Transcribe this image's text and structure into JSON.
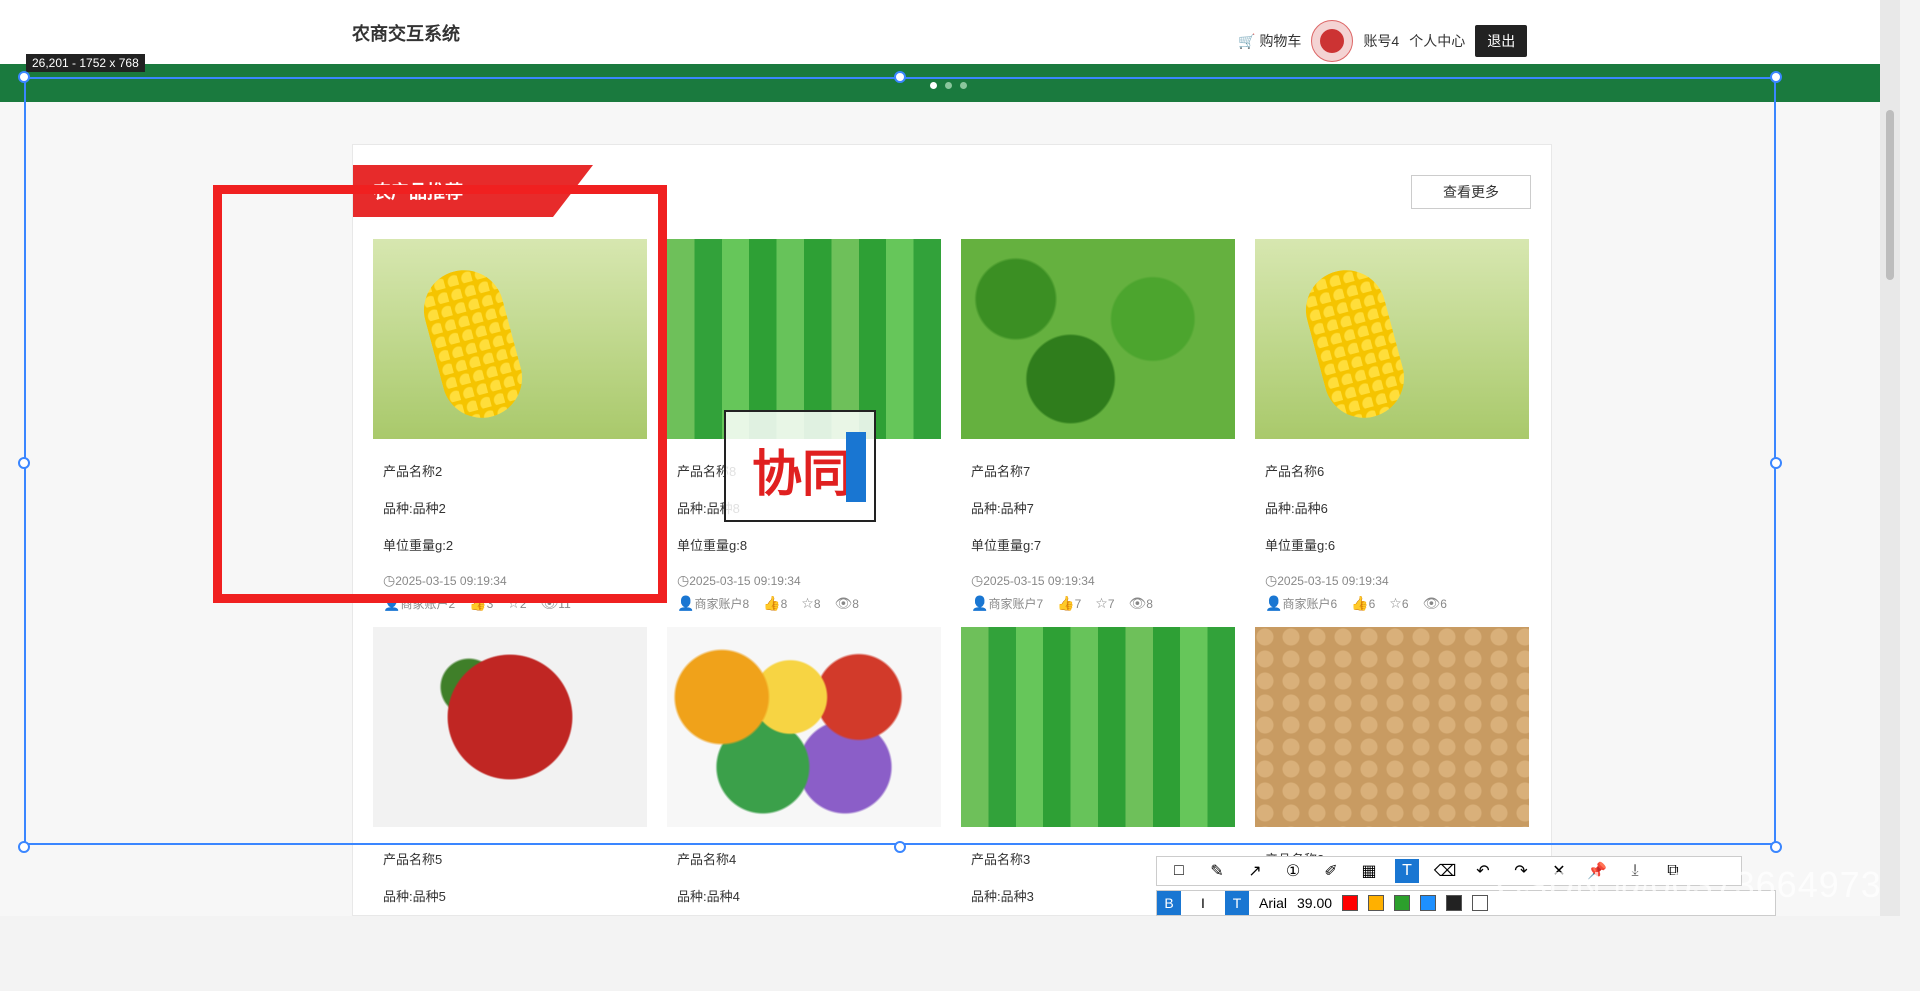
{
  "header": {
    "brand": "农商交互系统",
    "cart_label": "购物车",
    "account_label": "账号4",
    "personal_center": "个人中心",
    "logout": "退出"
  },
  "overlay": {
    "selection_size": "26,201 - 1752 x 768",
    "textbox_text": "协同"
  },
  "section": {
    "title": "农产品推荐",
    "more": "查看更多"
  },
  "products": [
    {
      "name": "产品名称2",
      "variety": "品种:品种2",
      "weight": "单位重量g:2",
      "time": "2025-03-15 09:19:34",
      "merchant": "商家账户2",
      "likes": "3",
      "stars": "2",
      "views": "11",
      "img": "corn"
    },
    {
      "name": "产品名称8",
      "variety": "品种:品种8",
      "weight": "单位重量g:8",
      "time": "2025-03-15 09:19:34",
      "merchant": "商家账户8",
      "likes": "8",
      "stars": "8",
      "views": "8",
      "img": "bitter"
    },
    {
      "name": "产品名称7",
      "variety": "品种:品种7",
      "weight": "单位重量g:7",
      "time": "2025-03-15 09:19:34",
      "merchant": "商家账户7",
      "likes": "7",
      "stars": "7",
      "views": "8",
      "img": "pepper"
    },
    {
      "name": "产品名称6",
      "variety": "品种:品种6",
      "weight": "单位重量g:6",
      "time": "2025-03-15 09:19:34",
      "merchant": "商家账户6",
      "likes": "6",
      "stars": "6",
      "views": "6",
      "img": "corn"
    },
    {
      "name": "产品名称5",
      "variety": "品种:品种5",
      "img": "chili"
    },
    {
      "name": "产品名称4",
      "variety": "品种:品种4",
      "img": "mixed"
    },
    {
      "name": "产品名称3",
      "variety": "品种:品种3",
      "img": "bitter"
    },
    {
      "name": "产品名称2",
      "img": "peanut"
    }
  ],
  "toolbar": {
    "font_name": "Arial",
    "font_size": "39.00",
    "bold": "B",
    "italic": "I",
    "strike": "T"
  },
  "watermark": "CSDN @00373664973"
}
